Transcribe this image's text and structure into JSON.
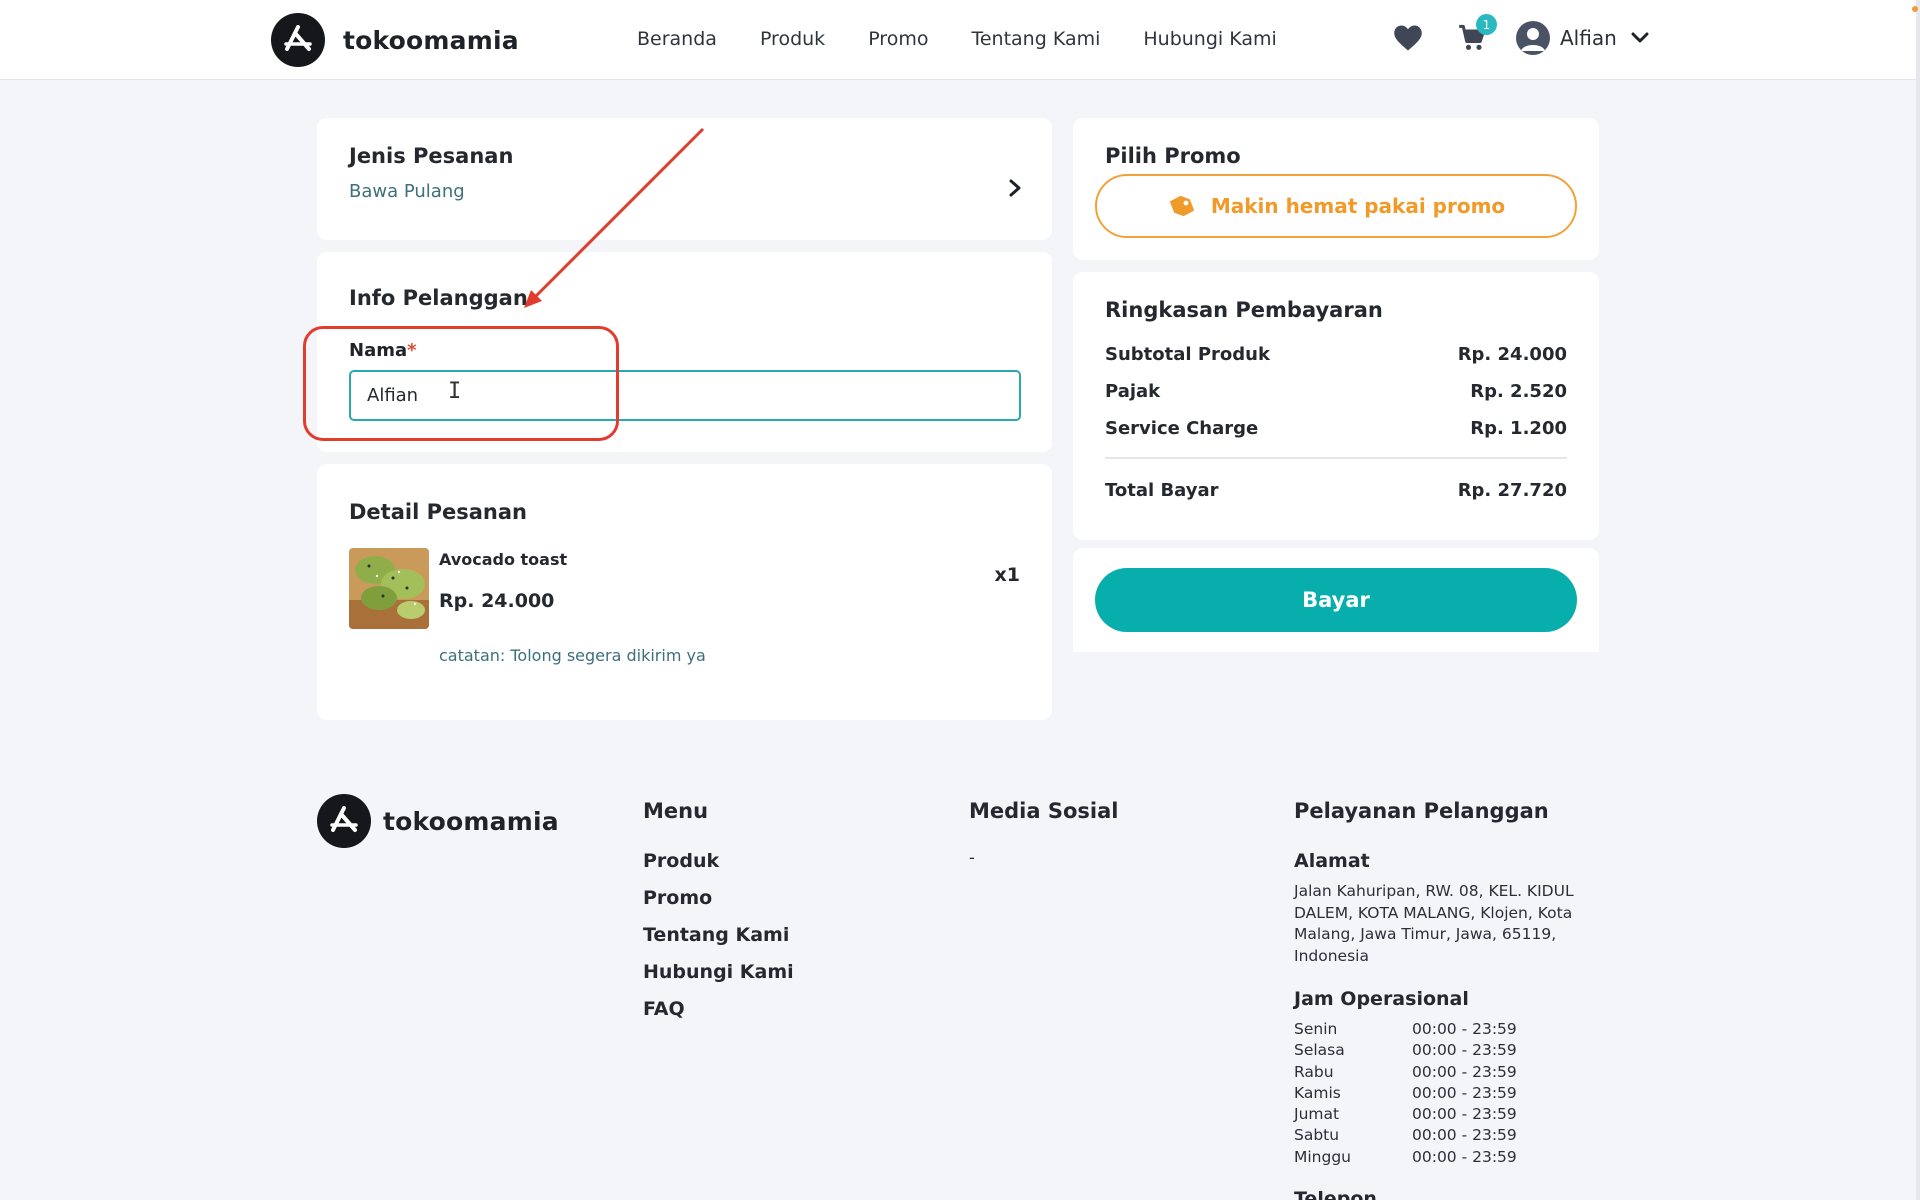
{
  "brand": {
    "name": "tokoomamia"
  },
  "nav": {
    "items": [
      "Beranda",
      "Produk",
      "Promo",
      "Tentang Kami",
      "Hubungi Kami"
    ]
  },
  "header": {
    "cart_count": "1",
    "user_name": "Alfian"
  },
  "order_type": {
    "title": "Jenis Pesanan",
    "value": "Bawa Pulang"
  },
  "customer_info": {
    "title": "Info Pelanggan",
    "name_label": "Nama",
    "required_mark": "*",
    "name_value": "Alfian"
  },
  "order_detail": {
    "title": "Detail Pesanan",
    "item": {
      "name": "Avocado toast",
      "price": "Rp. 24.000",
      "qty": "x1",
      "note": "catatan: Tolong segera dikirim ya"
    }
  },
  "promo": {
    "title": "Pilih Promo",
    "button_label": "Makin hemat pakai promo"
  },
  "summary": {
    "title": "Ringkasan Pembayaran",
    "rows": [
      {
        "label": "Subtotal Produk",
        "value": "Rp. 24.000"
      },
      {
        "label": "Pajak",
        "value": "Rp. 2.520"
      },
      {
        "label": "Service Charge",
        "value": "Rp. 1.200"
      }
    ],
    "total": {
      "label": "Total Bayar",
      "value": "Rp. 27.720"
    }
  },
  "pay_button": {
    "label": "Bayar"
  },
  "footer": {
    "menu_title": "Menu",
    "menu_items": [
      "Produk",
      "Promo",
      "Tentang Kami",
      "Hubungi Kami",
      "FAQ"
    ],
    "social_title": "Media Sosial",
    "social_value": "-",
    "service_title": "Pelayanan Pelanggan",
    "address_title": "Alamat",
    "address": "Jalan Kahuripan, RW. 08, KEL. KIDUL DALEM, KOTA MALANG, Klojen, Kota Malang, Jawa Timur, Jawa, 65119, Indonesia",
    "hours_title": "Jam Operasional",
    "hours": [
      {
        "day": "Senin",
        "time": "00:00 - 23:59"
      },
      {
        "day": "Selasa",
        "time": "00:00 - 23:59"
      },
      {
        "day": "Rabu",
        "time": "00:00 - 23:59"
      },
      {
        "day": "Kamis",
        "time": "00:00 - 23:59"
      },
      {
        "day": "Jumat",
        "time": "00:00 - 23:59"
      },
      {
        "day": "Sabtu",
        "time": "00:00 - 23:59"
      },
      {
        "day": "Minggu",
        "time": "00:00 - 23:59"
      }
    ],
    "phone_title_partial": "Telepon"
  },
  "colors": {
    "accent": "#08aeac",
    "promo": "#f09a2a",
    "annotation": "#e23c2e",
    "badge": "#2ab9c0"
  },
  "icons": [
    "logo-icon",
    "heart-icon",
    "cart-icon",
    "user-avatar-icon",
    "chevron-down-icon",
    "chevron-right-icon",
    "tag-icon"
  ]
}
